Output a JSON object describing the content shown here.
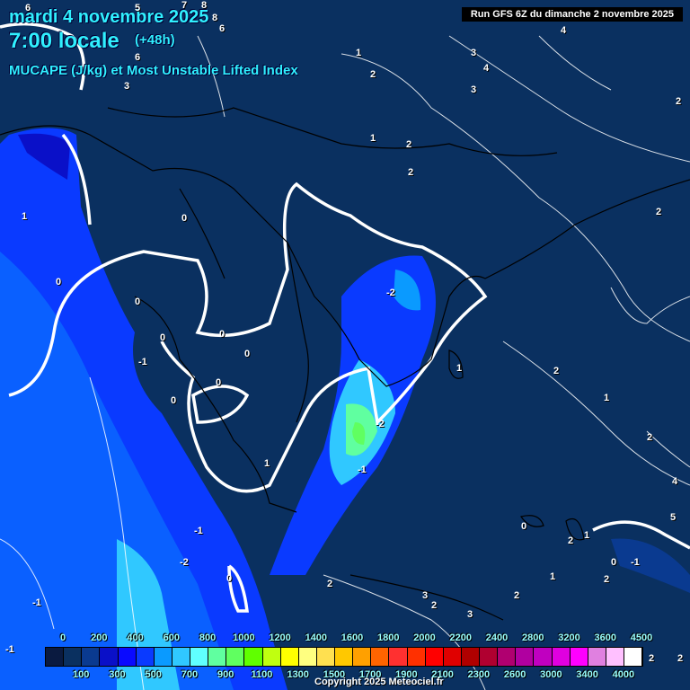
{
  "header": {
    "date": "mardi 4 novembre 2025",
    "time": "7:00 locale",
    "lead": "(+48h)",
    "parameter": "MUCAPE (J/kg) et Most Unstable Lifted Index",
    "run": "Run GFS 6Z du dimanche 2 novembre 2025"
  },
  "legend": {
    "top_labels": [
      "0",
      "200",
      "400",
      "600",
      "800",
      "1000",
      "1200",
      "1400",
      "1600",
      "1800",
      "2000",
      "2200",
      "2400",
      "2800",
      "3200",
      "3600",
      "4500"
    ],
    "bottom_labels": [
      "100",
      "300",
      "500",
      "700",
      "900",
      "1100",
      "1300",
      "1500",
      "1700",
      "1900",
      "2100",
      "2300",
      "2600",
      "3000",
      "3400",
      "4000"
    ],
    "colors": [
      "#0a1a40",
      "#0a3060",
      "#0a3a90",
      "#0a10c8",
      "#0a0aff",
      "#0a3aff",
      "#0a9aff",
      "#30c8ff",
      "#60ffff",
      "#60ffa0",
      "#60ff60",
      "#60ff00",
      "#c0ff10",
      "#ffff00",
      "#ffff80",
      "#ffe050",
      "#ffc800",
      "#ffa000",
      "#ff6400",
      "#ff3030",
      "#ff3000",
      "#ff0000",
      "#e00000",
      "#b00000",
      "#b00030",
      "#b00070",
      "#b000a0",
      "#c000c0",
      "#e000e0",
      "#ff00ff",
      "#e080e0",
      "#ffc0ff",
      "#ffffff"
    ]
  },
  "contour_labels": [
    "6",
    "5",
    "7",
    "8",
    "6",
    "8",
    "6",
    "3",
    "1",
    "0",
    "0",
    "0",
    "-1",
    "0",
    "0",
    "0",
    "0",
    "0",
    "-2",
    "-2",
    "-1",
    "1",
    "-1",
    "-2",
    "0",
    "-1",
    "1",
    "2",
    "2",
    "1",
    "2",
    "2",
    "2",
    "4",
    "4",
    "5",
    "0",
    "2",
    "1",
    "0",
    "-1",
    "2",
    "1",
    "2",
    "2",
    "3",
    "3",
    "2",
    "3",
    "4",
    "2",
    "3",
    "1",
    "1",
    "2",
    "2",
    "-1",
    "2"
  ],
  "copyright": "Copyright 2025 Meteociel.fr"
}
